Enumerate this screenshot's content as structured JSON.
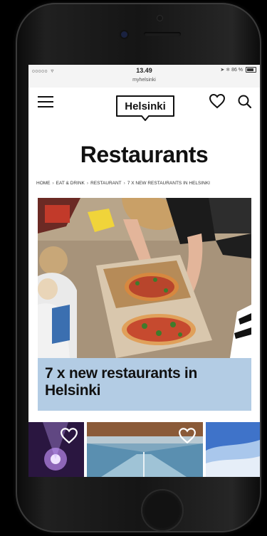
{
  "status_bar": {
    "carrier": "ooooo",
    "time": "13.49",
    "url": "myhelsinki",
    "battery": "86 %"
  },
  "header": {
    "logo_text": "Helsinki"
  },
  "page": {
    "title": "Restaurants"
  },
  "breadcrumb": {
    "items": [
      "HOME",
      "EAT & DRINK",
      "RESTAURANT",
      "7 X NEW RESTAURANTS IN HELSINKI"
    ],
    "separator": "›"
  },
  "hero": {
    "caption": "7 x new restaurants in Helsinki",
    "caption_bg": "#b3cce4"
  },
  "icons": {
    "menu": "hamburger-menu-icon",
    "favorite": "heart-icon",
    "search": "search-icon",
    "wifi": "wifi-icon",
    "battery": "battery-icon",
    "bluetooth": "bluetooth-icon",
    "location": "location-arrow-icon"
  }
}
